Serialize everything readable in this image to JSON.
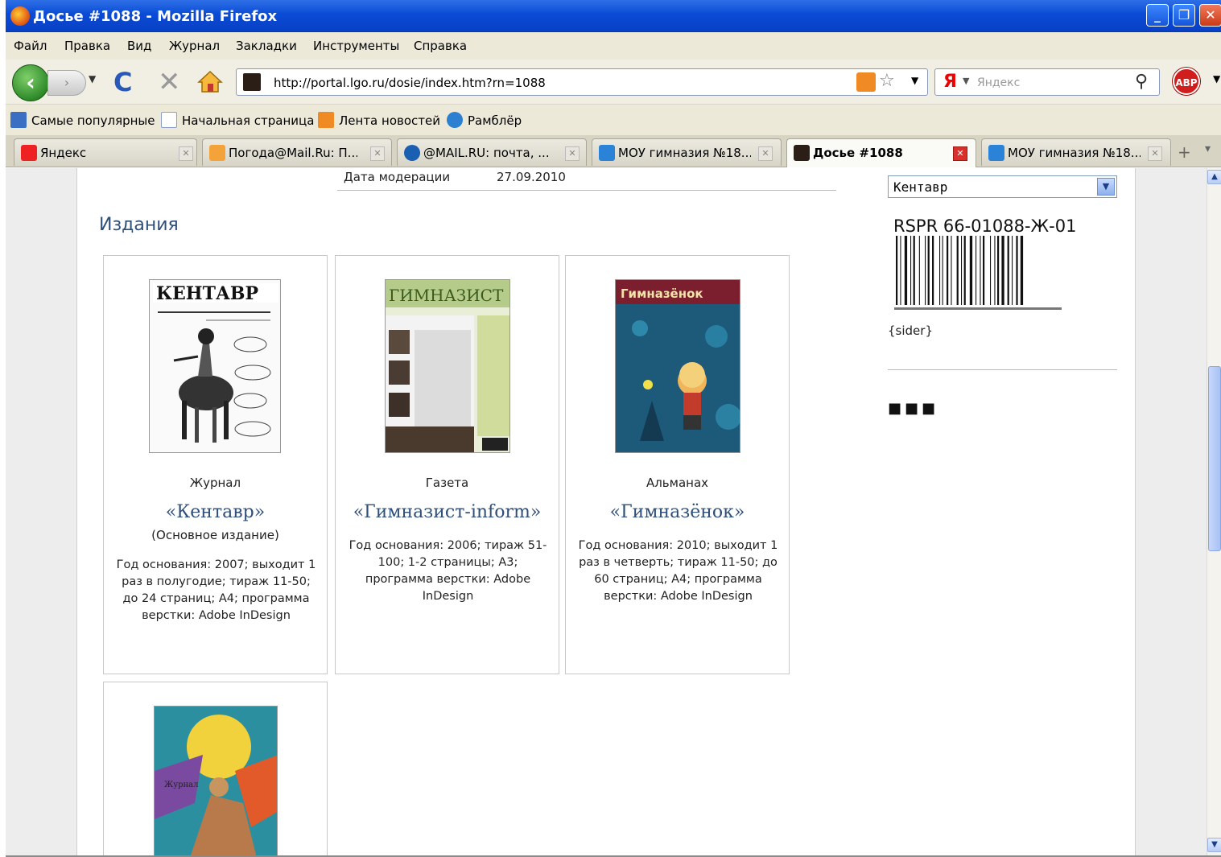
{
  "window": {
    "title": "Досье #1088 - Mozilla Firefox"
  },
  "menu": [
    "Файл",
    "Правка",
    "Вид",
    "Журнал",
    "Закладки",
    "Инструменты",
    "Справка"
  ],
  "navbar": {
    "url": "http://portal.lgo.ru/dosie/index.htm?rn=1088",
    "search_placeholder": "Яндекс",
    "search_engine_letter": "Я",
    "abp_label": "ABP"
  },
  "bookmarks": [
    "Самые популярные",
    "Начальная страница",
    "Лента новостей",
    "Рамблёр"
  ],
  "tabs": [
    {
      "label": "Яндекс",
      "active": false
    },
    {
      "label": "Погода@Mail.Ru: П...",
      "active": false
    },
    {
      "label": "@MAIL.RU: почта, ...",
      "active": false
    },
    {
      "label": "МОУ гимназия №18...",
      "active": false
    },
    {
      "label": "Досье #1088",
      "active": true
    },
    {
      "label": "МОУ гимназия №18...",
      "active": false
    }
  ],
  "page": {
    "moderation_label": "Дата модерации",
    "moderation_date": "27.09.2010",
    "section_title": "Издания",
    "publications": [
      {
        "type": "Журнал",
        "name": "«Кентавр»",
        "note": "(Основное издание)",
        "desc": "Год основания: 2007; выходит 1 раз в полугодие; тираж 11-50; до 24 страниц; А4; программа верстки: Adobe InDesign"
      },
      {
        "type": "Газета",
        "name": "«Гимназист-inform»",
        "note": "",
        "desc": "Год основания: 2006; тираж 51-100; 1-2 страницы; А3; программа верстки: Adobe InDesign"
      },
      {
        "type": "Альманах",
        "name": "«Гимназёнок»",
        "note": "",
        "desc": "Год основания: 2010; выходит 1 раз в четверть; тираж 11-50; до 60 страниц; А4; программа верстки: Adobe InDesign"
      }
    ],
    "sidebar": {
      "selected_edition": "Кентавр",
      "rspr": "RSPR 66-01088-Ж-01",
      "sider": "{sider}",
      "dots": "■■■"
    }
  },
  "colors": {
    "title_bar": "#0a4bd6",
    "link_blue": "#2f4f7a",
    "chrome_bg": "#ece9d8"
  }
}
